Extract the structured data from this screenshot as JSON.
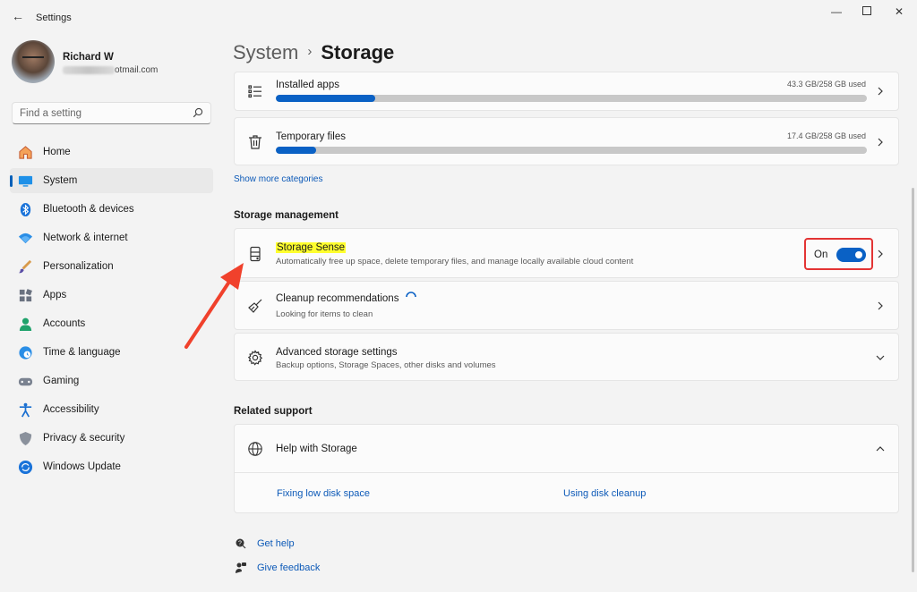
{
  "window": {
    "title": "Settings",
    "back_icon": "back-arrow-icon",
    "minimize_icon": "minimize-icon",
    "maximize_icon": "maximize-icon",
    "close_icon": "close-icon"
  },
  "profile": {
    "name": "Richard W",
    "email_suffix": "otmail.com"
  },
  "search": {
    "placeholder": "Find a setting"
  },
  "sidebar": {
    "items": [
      {
        "label": "Home",
        "icon": "home-icon"
      },
      {
        "label": "System",
        "icon": "system-icon",
        "active": true
      },
      {
        "label": "Bluetooth & devices",
        "icon": "bluetooth-icon"
      },
      {
        "label": "Network & internet",
        "icon": "network-icon"
      },
      {
        "label": "Personalization",
        "icon": "brush-icon"
      },
      {
        "label": "Apps",
        "icon": "apps-icon"
      },
      {
        "label": "Accounts",
        "icon": "accounts-icon"
      },
      {
        "label": "Time & language",
        "icon": "globe-clock-icon"
      },
      {
        "label": "Gaming",
        "icon": "gamepad-icon"
      },
      {
        "label": "Accessibility",
        "icon": "accessibility-icon"
      },
      {
        "label": "Privacy & security",
        "icon": "shield-icon"
      },
      {
        "label": "Windows Update",
        "icon": "update-icon"
      }
    ]
  },
  "breadcrumb": {
    "parent": "System",
    "separator": "›",
    "current": "Storage"
  },
  "categories": [
    {
      "title": "Installed apps",
      "usage": "43.3 GB/258 GB used",
      "fraction": 0.168,
      "icon": "list-icon"
    },
    {
      "title": "Temporary files",
      "usage": "17.4 GB/258 GB used",
      "fraction": 0.068,
      "icon": "trash-icon"
    }
  ],
  "show_more": "Show more categories",
  "storage_management": {
    "heading": "Storage management",
    "storage_sense": {
      "title": "Storage Sense",
      "subtitle": "Automatically free up space, delete temporary files, and manage locally available cloud content",
      "toggle_state": "On",
      "toggle_on": true
    },
    "cleanup": {
      "title": "Cleanup recommendations",
      "subtitle": "Looking for items to clean"
    },
    "advanced": {
      "title": "Advanced storage settings",
      "subtitle": "Backup options, Storage Spaces, other disks and volumes"
    }
  },
  "related_support": {
    "heading": "Related support",
    "help_title": "Help with Storage",
    "links": [
      "Fixing low disk space",
      "Using disk cleanup"
    ]
  },
  "footer": {
    "get_help": "Get help",
    "give_feedback": "Give feedback"
  },
  "colors": {
    "accent": "#0a61c5",
    "highlight": "#ffff2e",
    "annotation": "#e33434"
  }
}
